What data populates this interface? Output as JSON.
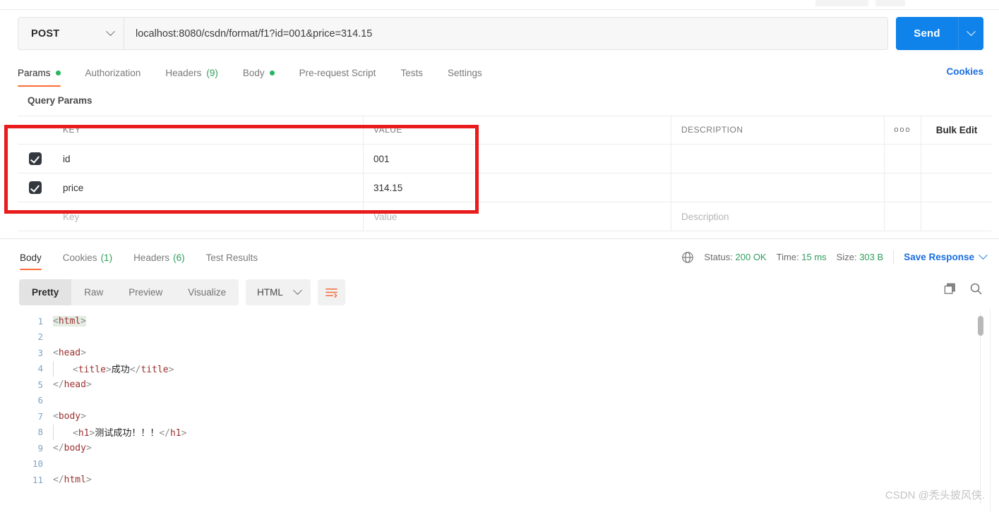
{
  "request": {
    "method": "POST",
    "url": "localhost:8080/csdn/format/f1?id=001&price=314.15",
    "send_label": "Send",
    "cookies_link": "Cookies",
    "tabs": [
      {
        "label": "Params",
        "badge": "dot"
      },
      {
        "label": "Authorization",
        "badge": ""
      },
      {
        "label": "Headers",
        "count": "(9)"
      },
      {
        "label": "Body",
        "badge": "dot"
      },
      {
        "label": "Pre-request Script",
        "badge": ""
      },
      {
        "label": "Tests",
        "badge": ""
      },
      {
        "label": "Settings",
        "badge": ""
      }
    ]
  },
  "params": {
    "section_title": "Query Params",
    "columns": {
      "key": "KEY",
      "value": "VALUE",
      "description": "DESCRIPTION"
    },
    "options_icon": "ooo",
    "bulk_edit_label": "Bulk Edit",
    "rows": [
      {
        "checked": true,
        "key": "id",
        "value": "001",
        "description": ""
      },
      {
        "checked": true,
        "key": "price",
        "value": "314.15",
        "description": ""
      }
    ],
    "empty_row": {
      "key_placeholder": "Key",
      "value_placeholder": "Value",
      "description_placeholder": "Description"
    },
    "highlight_color": "#e81c1c"
  },
  "response": {
    "tabs": [
      {
        "label": "Body",
        "count": ""
      },
      {
        "label": "Cookies",
        "count": "(1)"
      },
      {
        "label": "Headers",
        "count": "(6)"
      },
      {
        "label": "Test Results",
        "count": ""
      }
    ],
    "status_label": "Status:",
    "status_value": "200 OK",
    "time_label": "Time:",
    "time_value": "15 ms",
    "size_label": "Size:",
    "size_value": "303 B",
    "save_response_label": "Save Response",
    "format_tabs": [
      "Pretty",
      "Raw",
      "Preview",
      "Visualize"
    ],
    "active_format": "Pretty",
    "language": "HTML",
    "globe_icon": "globe-icon",
    "wrap_icon": "word-wrap-icon",
    "copy_icon": "copy-icon",
    "search_icon": "search-icon",
    "code_lines": [
      {
        "n": "1",
        "indent": false,
        "tokens": [
          {
            "t": "br",
            "v": "<"
          },
          {
            "t": "tg",
            "v": "html"
          },
          {
            "t": "br",
            "v": ">"
          }
        ],
        "selected": true
      },
      {
        "n": "2",
        "indent": false,
        "tokens": []
      },
      {
        "n": "3",
        "indent": false,
        "tokens": [
          {
            "t": "br",
            "v": "<"
          },
          {
            "t": "tg",
            "v": "head"
          },
          {
            "t": "br",
            "v": ">"
          }
        ]
      },
      {
        "n": "4",
        "indent": true,
        "tokens": [
          {
            "t": "br",
            "v": "<"
          },
          {
            "t": "tg",
            "v": "title"
          },
          {
            "t": "br",
            "v": ">"
          },
          {
            "t": "txt",
            "v": "成功"
          },
          {
            "t": "br",
            "v": "</"
          },
          {
            "t": "tg",
            "v": "title"
          },
          {
            "t": "br",
            "v": ">"
          }
        ]
      },
      {
        "n": "5",
        "indent": false,
        "tokens": [
          {
            "t": "br",
            "v": "</"
          },
          {
            "t": "tg",
            "v": "head"
          },
          {
            "t": "br",
            "v": ">"
          }
        ]
      },
      {
        "n": "6",
        "indent": false,
        "tokens": []
      },
      {
        "n": "7",
        "indent": false,
        "tokens": [
          {
            "t": "br",
            "v": "<"
          },
          {
            "t": "tg",
            "v": "body"
          },
          {
            "t": "br",
            "v": ">"
          }
        ]
      },
      {
        "n": "8",
        "indent": true,
        "tokens": [
          {
            "t": "br",
            "v": "<"
          },
          {
            "t": "tg",
            "v": "h1"
          },
          {
            "t": "br",
            "v": ">"
          },
          {
            "t": "txt",
            "v": "测试成功！！！"
          },
          {
            "t": "br",
            "v": "</"
          },
          {
            "t": "tg",
            "v": "h1"
          },
          {
            "t": "br",
            "v": ">"
          }
        ]
      },
      {
        "n": "9",
        "indent": false,
        "tokens": [
          {
            "t": "br",
            "v": "</"
          },
          {
            "t": "tg",
            "v": "body"
          },
          {
            "t": "br",
            "v": ">"
          }
        ]
      },
      {
        "n": "10",
        "indent": false,
        "tokens": []
      },
      {
        "n": "11",
        "indent": false,
        "tokens": [
          {
            "t": "br",
            "v": "</"
          },
          {
            "t": "tg",
            "v": "html"
          },
          {
            "t": "br",
            "v": ">"
          }
        ]
      }
    ]
  },
  "watermark": "CSDN @秃头披风侠."
}
